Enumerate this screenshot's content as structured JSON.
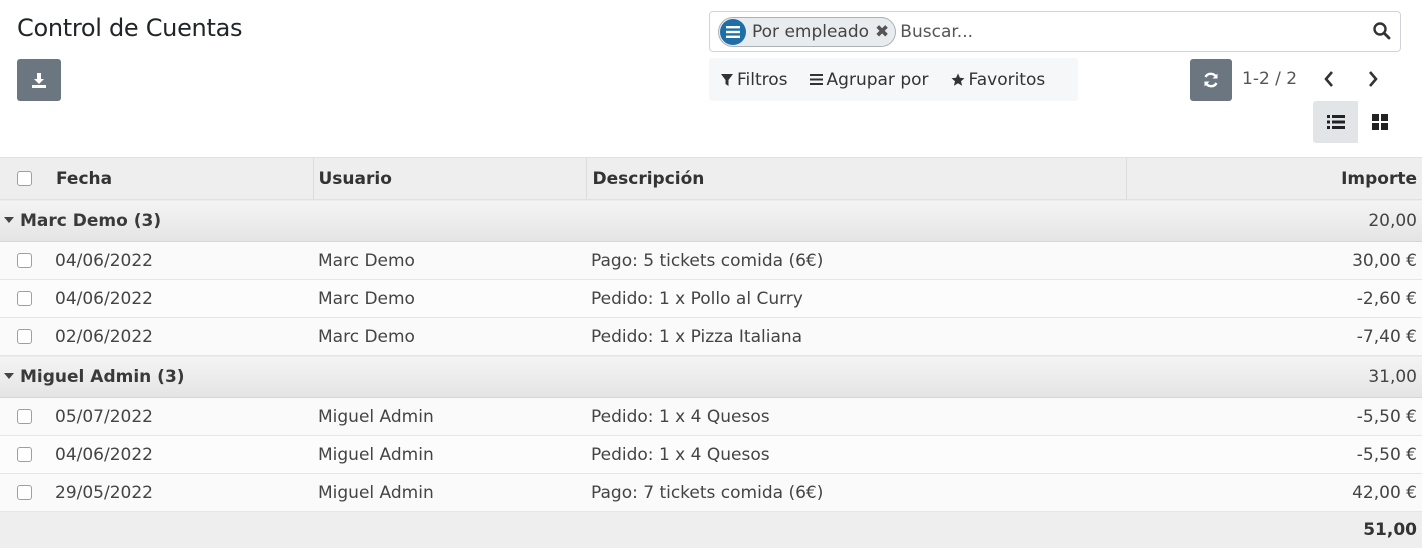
{
  "page": {
    "title": "Control de Cuentas"
  },
  "search": {
    "facet_label": "Por empleado",
    "facet_close": "✖",
    "placeholder": "Buscar..."
  },
  "filters": {
    "filters_label": "Filtros",
    "group_label": "Agrupar por",
    "favorites_label": "Favoritos"
  },
  "pager": {
    "value": "1-2 / 2"
  },
  "table": {
    "headers": [
      "Fecha",
      "Usuario",
      "Descripción",
      "Importe"
    ],
    "groups": [
      {
        "label": "Marc Demo (3)",
        "total": "20,00",
        "rows": [
          {
            "date": "04/06/2022",
            "user": "Marc Demo",
            "description": "Pago: 5 tickets comida (6€)",
            "amount": "30,00 €"
          },
          {
            "date": "04/06/2022",
            "user": "Marc Demo",
            "description": "Pedido: 1 x Pollo al Curry",
            "amount": "-2,60 €"
          },
          {
            "date": "02/06/2022",
            "user": "Marc Demo",
            "description": "Pedido: 1 x Pizza Italiana",
            "amount": "-7,40 €"
          }
        ]
      },
      {
        "label": "Miguel Admin (3)",
        "total": "31,00",
        "rows": [
          {
            "date": "05/07/2022",
            "user": "Miguel Admin",
            "description": "Pedido: 1 x 4 Quesos",
            "amount": "-5,50 €"
          },
          {
            "date": "04/06/2022",
            "user": "Miguel Admin",
            "description": "Pedido: 1 x 4 Quesos",
            "amount": "-5,50 €"
          },
          {
            "date": "29/05/2022",
            "user": "Miguel Admin",
            "description": "Pago: 7 tickets comida (6€)",
            "amount": "42,00 €"
          }
        ]
      }
    ],
    "grand_total": "51,00"
  },
  "icons": {
    "download": "download-icon",
    "search": "search-icon",
    "facet": "list-icon",
    "filter": "filter-icon",
    "group": "bars-icon",
    "favorites": "star-icon",
    "refresh": "refresh-icon",
    "prev": "chevron-left-icon",
    "next": "chevron-right-icon",
    "list_view": "list-view-icon",
    "kanban_view": "kanban-view-icon"
  },
  "colors": {
    "facet_icon": "#1e6fa8",
    "button_bg": "#6c7680"
  }
}
